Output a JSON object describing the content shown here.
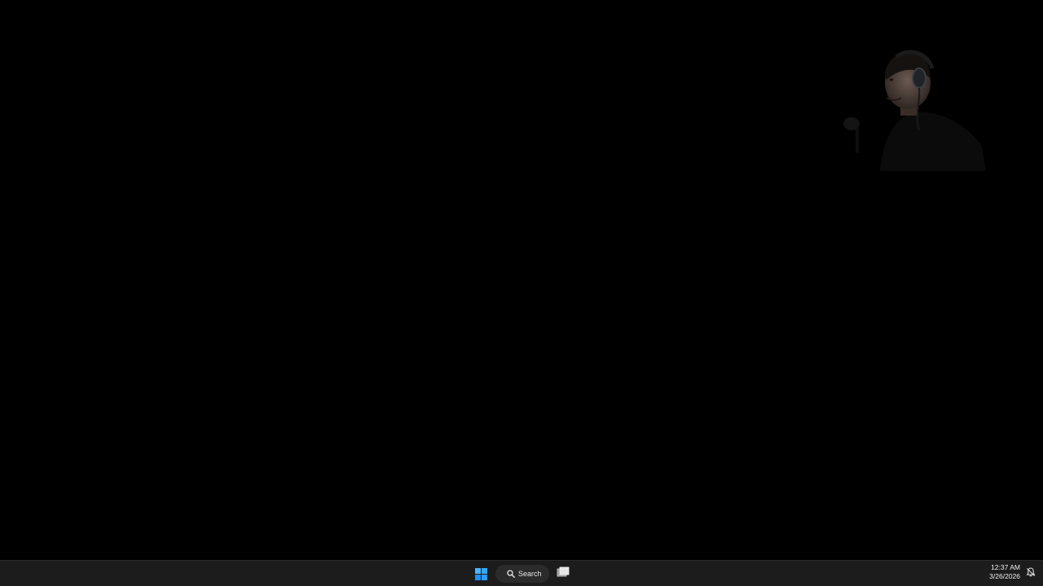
{
  "taskbar": {
    "search_label": "Search",
    "time": "12:37 AM",
    "date": "3/26/2026"
  },
  "icons": {
    "start": "windows-logo-icon",
    "search": "search-icon",
    "task_view": "task-view-icon",
    "notifications": "notification-bell-icon"
  },
  "colors": {
    "desktop_background": "#000000",
    "taskbar_background": "#1c1c1c",
    "accent": "#3aa0ff"
  }
}
